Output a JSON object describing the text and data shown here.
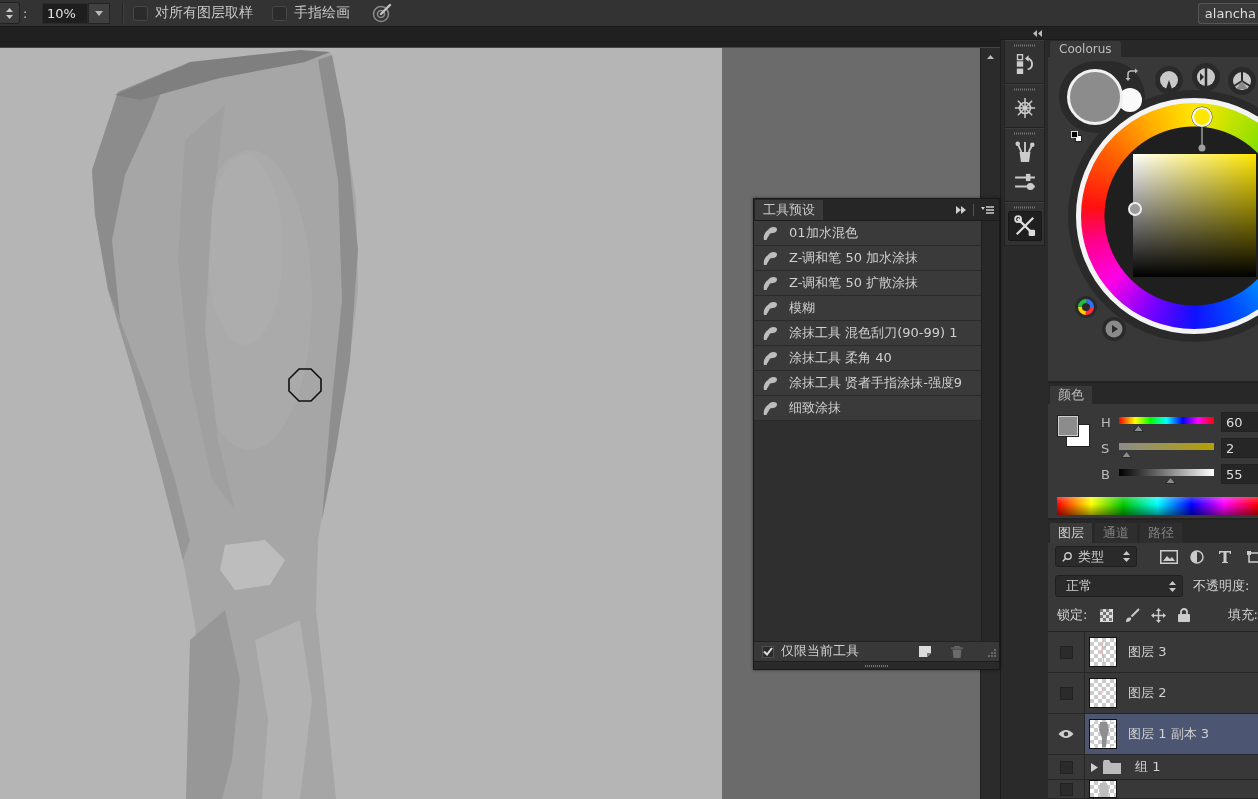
{
  "options_bar": {
    "field_label": ":",
    "strength": {
      "value": "10%"
    },
    "options": [
      {
        "label": "对所有图层取样",
        "checked": false
      },
      {
        "label": "手指绘画",
        "checked": false
      }
    ],
    "workspace": "alancha"
  },
  "tool_presets": {
    "title": "工具预设",
    "presets": [
      {
        "name": "01加水混色",
        "selected": false
      },
      {
        "name": "Z-调和笔 50 加水涂抹",
        "selected": false
      },
      {
        "name": "Z-调和笔 50 扩散涂抹",
        "selected": false
      },
      {
        "name": "模糊",
        "selected": false
      },
      {
        "name": "涂抹工具 混色刮刀(90-99) 1",
        "selected": false
      },
      {
        "name": "涂抹工具 柔角 40",
        "selected": false
      },
      {
        "name": "涂抹工具 贤者手指涂抹-强度9",
        "selected": false
      },
      {
        "name": "细致涂抹",
        "selected": false
      }
    ],
    "current_tool_only": {
      "label": "仅限当前工具",
      "checked": true
    },
    "footer_buttons": [
      {
        "kind": "new",
        "disabled": false
      },
      {
        "kind": "delete",
        "disabled": true
      }
    ]
  },
  "dock": [
    {
      "buttons": [
        {
          "kind": "history",
          "selected": false
        }
      ]
    },
    {
      "buttons": [
        {
          "kind": "navigator",
          "selected": false
        }
      ]
    },
    {
      "buttons": [
        {
          "kind": "brushes",
          "selected": false
        },
        {
          "kind": "presets",
          "selected": false
        }
      ]
    },
    {
      "buttons": [
        {
          "kind": "tools",
          "selected": true
        }
      ]
    }
  ],
  "coolorus": {
    "title": "Coolorus"
  },
  "color_panel": {
    "title": "颜色",
    "channels": [
      {
        "kind": "hue",
        "label": "H",
        "level": 0.17,
        "value": "60"
      },
      {
        "kind": "saturation",
        "label": "S",
        "level": 0.02,
        "value": "2"
      },
      {
        "kind": "brightness",
        "label": "B",
        "level": 0.55,
        "value": "55"
      }
    ]
  },
  "layers_panel": {
    "tabs": [
      {
        "label": "图层",
        "selected": true
      },
      {
        "label": "通道",
        "selected": false
      },
      {
        "label": "路径",
        "selected": false
      }
    ],
    "filter": "类型",
    "blend_mode": "正常",
    "opacity_label": "不透明度:",
    "lock_label": "锁定:",
    "fill_label": "填充:",
    "layers": [
      {
        "kind": "layer",
        "name": "图层 3",
        "visible": false,
        "selected": false
      },
      {
        "kind": "layer",
        "name": "图层 2",
        "visible": false,
        "selected": false
      },
      {
        "kind": "layer",
        "name": "图层 1 副本 3",
        "visible": true,
        "selected": true
      },
      {
        "kind": "group",
        "name": "组 1",
        "visible": false,
        "selected": false,
        "expanded": false
      },
      {
        "kind": "layer",
        "visible": false,
        "selected": false
      }
    ]
  }
}
